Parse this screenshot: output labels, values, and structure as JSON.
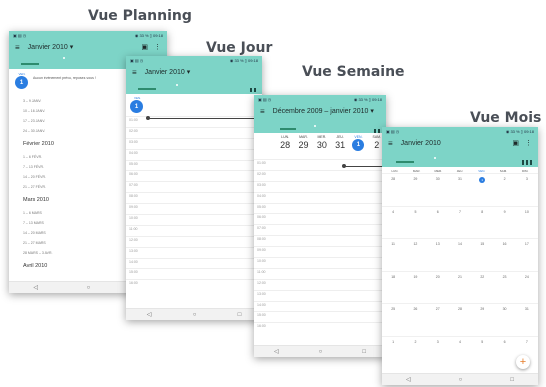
{
  "captions": {
    "planning": "Vue Planning",
    "day": "Vue Jour",
    "week": "Vue Semaine",
    "month": "Vue Mois"
  },
  "status_bar": {
    "icons": "▣ ▤ ◷",
    "right": "◉ 33 % ▯ 09:18"
  },
  "nav": {
    "back": "◁",
    "home": "○",
    "recent": "□"
  },
  "icons": {
    "menu": "menu-icon",
    "calendar": "calendar-today-icon",
    "more": "more-vert-icon",
    "add": "add-icon"
  },
  "colors": {
    "appbar": "#7dd4c7",
    "today": "#2a7de1",
    "fab_plus": "#e57c2a"
  },
  "planning": {
    "title": "Janvier 2010 ▾",
    "day_label": "VEN.",
    "day_number": "1",
    "first_event": "Aucun événement prévu, reposez-vous !",
    "january_items": [
      "3 – 9 JANV.",
      "10 – 16 JANV.",
      "17 – 23 JANV.",
      "24 – 30 JANV."
    ],
    "february": "Février 2010",
    "february_items": [
      "1 – 6 FÉVR.",
      "7 – 13 FÉVR.",
      "14 – 20 FÉVR.",
      "21 – 27 FÉVR."
    ],
    "march": "Mars 2010",
    "march_items": [
      "1 – 6 MARS",
      "7 – 13 MARS",
      "14 – 20 MARS",
      "21 – 27 MARS",
      "28 MARS – 3 AVR."
    ],
    "april": "Avril 2010"
  },
  "day": {
    "title": "Janvier 2010 ▾",
    "day_label": "VEN.",
    "day_number": "1",
    "hours": [
      "01:00",
      "02:00",
      "03:00",
      "04:00",
      "05:00",
      "06:00",
      "07:00",
      "08:00",
      "09:00",
      "10:00",
      "11:00",
      "12:00",
      "13:00",
      "14:00",
      "15:00",
      "16:00"
    ]
  },
  "week": {
    "title": "Décembre 2009 – janvier 2010 ▾",
    "days": [
      {
        "name": "LUN.",
        "num": "28"
      },
      {
        "name": "MAR.",
        "num": "29"
      },
      {
        "name": "MER.",
        "num": "30"
      },
      {
        "name": "JEU.",
        "num": "31"
      },
      {
        "name": "VEN.",
        "num": "1"
      },
      {
        "name": "SAM.",
        "num": "2"
      }
    ],
    "hours": [
      "01:00",
      "02:00",
      "03:00",
      "04:00",
      "05:00",
      "06:00",
      "07:00",
      "08:00",
      "09:00",
      "10:00",
      "11:00",
      "12:00",
      "13:00",
      "14:00",
      "15:00",
      "16:00"
    ]
  },
  "month": {
    "title": "Janvier 2010",
    "weekdays": [
      "LUN.",
      "MAR.",
      "MER.",
      "JEU.",
      "VEN.",
      "SAM.",
      "DIM."
    ],
    "weeks": [
      [
        "28",
        "29",
        "30",
        "31",
        "1",
        "2",
        "3"
      ],
      [
        "4",
        "5",
        "6",
        "7",
        "8",
        "9",
        "10"
      ],
      [
        "11",
        "12",
        "13",
        "14",
        "15",
        "16",
        "17"
      ],
      [
        "18",
        "19",
        "20",
        "21",
        "22",
        "23",
        "24"
      ],
      [
        "25",
        "26",
        "27",
        "28",
        "29",
        "30",
        "31"
      ],
      [
        "1",
        "2",
        "3",
        "4",
        "5",
        "6",
        "7"
      ]
    ],
    "today": "1",
    "fab": "+"
  }
}
